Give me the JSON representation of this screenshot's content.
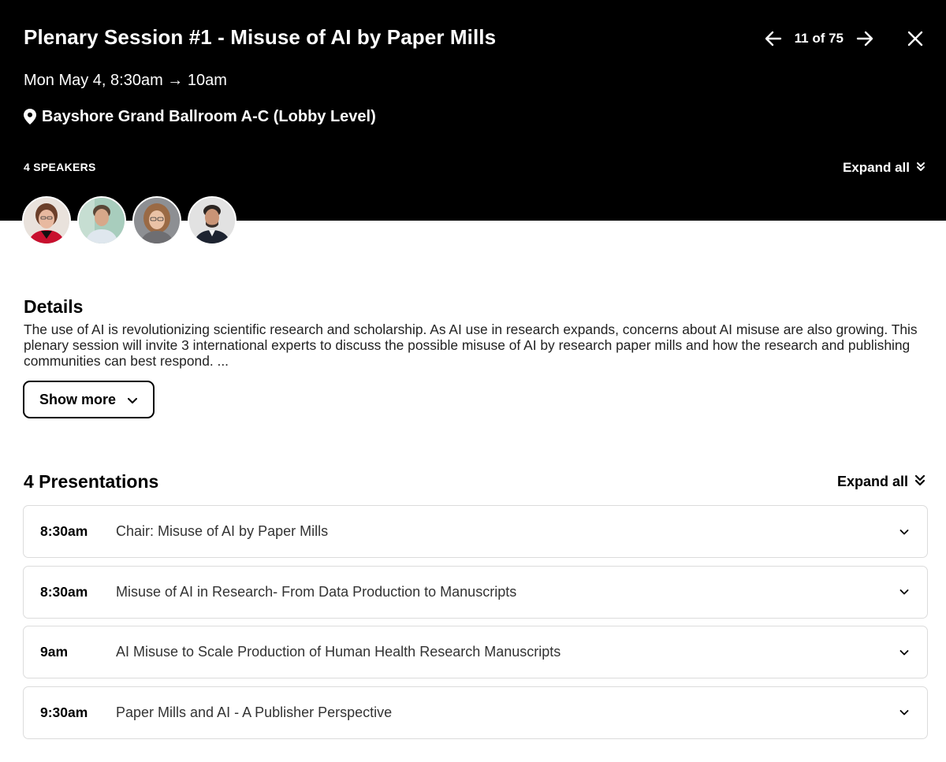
{
  "session": {
    "title": "Plenary Session #1 - Misuse of AI by Paper Mills",
    "datetime": "Mon May 4, 8:30am → 10am",
    "location": "Bayshore Grand Ballroom A-C (Lobby Level)"
  },
  "nav": {
    "counter": "11 of 75",
    "prev_icon": "arrow-left-icon",
    "next_icon": "arrow-right-icon",
    "close_icon": "close-icon"
  },
  "speakers": {
    "count_label": "4 SPEAKERS",
    "expand_label": "Expand all"
  },
  "details": {
    "heading": "Details",
    "text": "The use of AI is revolutionizing scientific research and scholarship. As AI use in research expands, concerns about AI misuse are also growing. This plenary session will invite 3 international experts to discuss the possible misuse of AI by research paper mills and how the research and publishing communities can best respond. ...",
    "show_more_label": "Show more"
  },
  "presentations": {
    "heading": "4 Presentations",
    "expand_label": "Expand all",
    "items": [
      {
        "time": "8:30am",
        "title": "Chair: Misuse of AI by Paper Mills"
      },
      {
        "time": "8:30am",
        "title": "Misuse of AI in Research- From Data Production to Manuscripts"
      },
      {
        "time": "9am",
        "title": "AI Misuse to Scale Production of Human Health Research Manuscripts"
      },
      {
        "time": "9:30am",
        "title": "Paper Mills and AI - A Publisher Perspective"
      }
    ]
  },
  "colors": {
    "header_bg": "#000000",
    "header_text": "#ffffff",
    "border": "#dcdcdc"
  }
}
